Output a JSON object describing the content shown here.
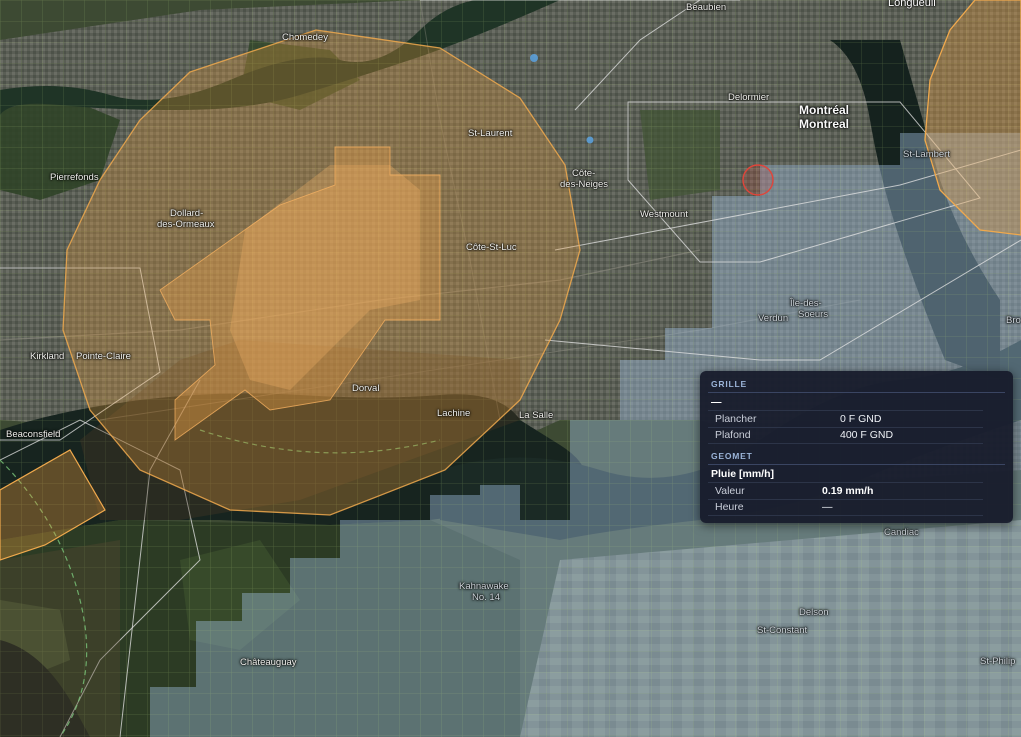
{
  "map": {
    "labels": {
      "longueuil": "Longueuil",
      "beaubien": "Beaubien",
      "chomedey": "Chomedey",
      "delormier": "Delormier",
      "montreal_fr": "Montréal",
      "montreal_en": "Montreal",
      "st_laurent": "St-Laurent",
      "pierrefonds": "Pierrefonds",
      "cote_des_neiges_1": "Côte-",
      "cote_des_neiges_2": "des-Neiges",
      "st_lambert": "St-Lambert",
      "dollard_1": "Dollard-",
      "dollard_2": "des-Ormeaux",
      "westmount": "Westmount",
      "cote_st_luc": "Côte-St-Luc",
      "ile_des_soeurs_1": "Île-des-",
      "ile_des_soeurs_2": "Soeurs",
      "verdun": "Verdun",
      "brossard": "Bro",
      "kirkland": "Kirkland",
      "pointe_claire": "Pointe-Claire",
      "dorval": "Dorval",
      "lachine": "Lachine",
      "la_salle": "La Salle",
      "beaconsfield": "Beaconsfield",
      "candiac": "Candiac",
      "kahnawake_1": "Kahnawake",
      "kahnawake_2": "No. 14",
      "delson": "Delson",
      "st_constant": "St-Constant",
      "st_philippe": "St-Philip",
      "chateauguay": "Châteauguay"
    },
    "colors": {
      "airspace_orange": "#e89a3c",
      "grid_blue": "#a9c7e6",
      "grid_line": "#b9d08a",
      "outline_white": "#e6e6e6",
      "marker_red": "#e0453a"
    }
  },
  "panel": {
    "grille": {
      "title": "GRILLE",
      "name": "—",
      "rows": [
        {
          "key": "Plancher",
          "value": "0 F GND"
        },
        {
          "key": "Plafond",
          "value": "400 F GND"
        }
      ]
    },
    "geomet": {
      "title": "GEOMET",
      "name": "Pluie [mm/h]",
      "rows": [
        {
          "key": "Valeur",
          "value": "0.19 mm/h"
        },
        {
          "key": "Heure",
          "value": "—"
        }
      ]
    }
  }
}
